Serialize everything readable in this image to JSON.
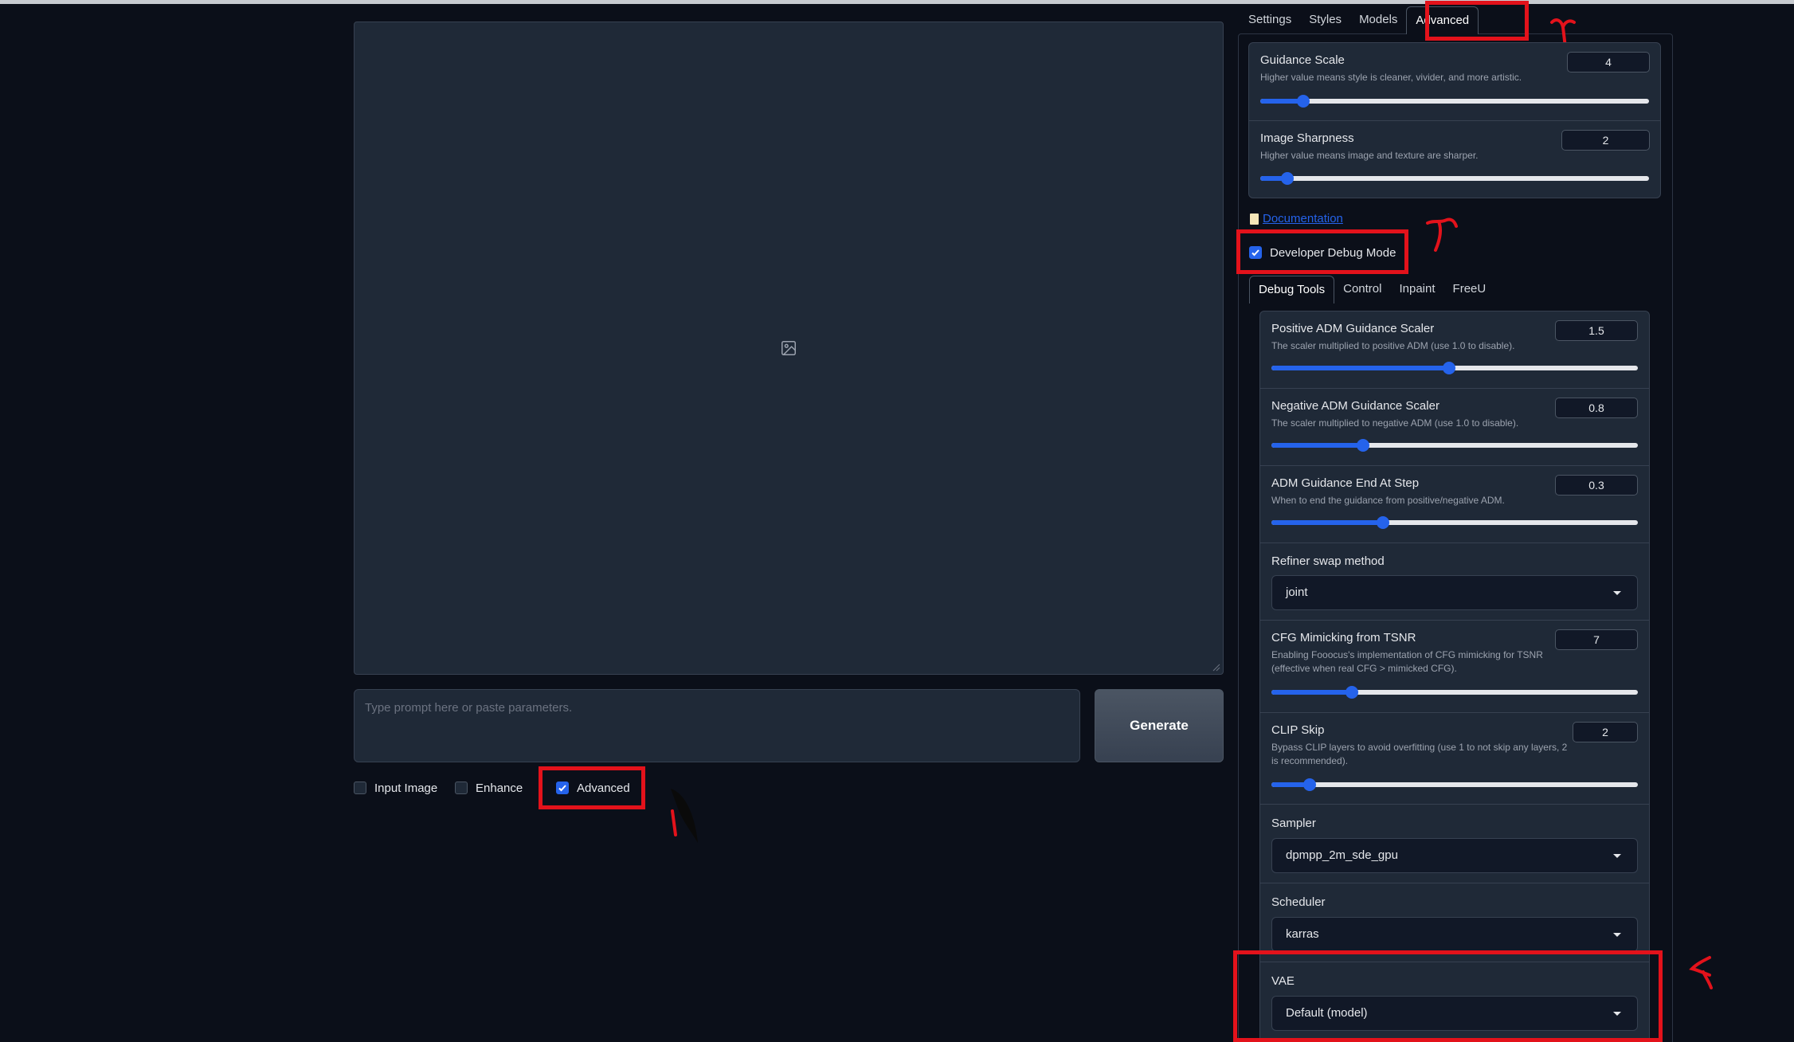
{
  "left": {
    "prompt_placeholder": "Type prompt here or paste parameters.",
    "generate_label": "Generate",
    "checkboxes": [
      {
        "label": "Input Image",
        "checked": false
      },
      {
        "label": "Enhance",
        "checked": false
      },
      {
        "label": "Advanced",
        "checked": true
      }
    ]
  },
  "top_tabs": [
    "Settings",
    "Styles",
    "Models",
    "Advanced"
  ],
  "active_top_tab": "Advanced",
  "guidance_scale": {
    "label": "Guidance Scale",
    "desc": "Higher value means style is cleaner, vivider, and more artistic.",
    "value": "4",
    "fraction": 0.11
  },
  "image_sharpness": {
    "label": "Image Sharpness",
    "desc": "Higher value means image and texture are sharper.",
    "value": "2",
    "fraction": 0.07
  },
  "documentation_label": "Documentation",
  "developer_debug_mode": {
    "label": "Developer Debug Mode",
    "checked": true
  },
  "inner_tabs": [
    "Debug Tools",
    "Control",
    "Inpaint",
    "FreeU"
  ],
  "active_inner_tab": "Debug Tools",
  "positive_adm": {
    "label": "Positive ADM Guidance Scaler",
    "desc": "The scaler multiplied to positive ADM (use 1.0 to disable).",
    "value": "1.5",
    "fraction": 0.485
  },
  "negative_adm": {
    "label": "Negative ADM Guidance Scaler",
    "desc": "The scaler multiplied to negative ADM (use 1.0 to disable).",
    "value": "0.8",
    "fraction": 0.25
  },
  "adm_end": {
    "label": "ADM Guidance End At Step",
    "desc": "When to end the guidance from positive/negative ADM.",
    "value": "0.3",
    "fraction": 0.305
  },
  "refiner_swap": {
    "label": "Refiner swap method",
    "value": "joint"
  },
  "cfg_mimicking": {
    "label": "CFG Mimicking from TSNR",
    "desc1": "Enabling Fooocus's implementation of CFG mimicking for TSNR",
    "desc2": "(effective when real CFG > mimicked CFG).",
    "value": "7",
    "fraction": 0.22
  },
  "clip_skip": {
    "label": "CLIP Skip",
    "desc1": "Bypass CLIP layers to avoid overfitting (use 1 to not skip any layers, 2",
    "desc2": "is recommended).",
    "value": "2",
    "fraction": 0.105
  },
  "sampler": {
    "label": "Sampler",
    "value": "dpmpp_2m_sde_gpu"
  },
  "scheduler": {
    "label": "Scheduler",
    "value": "karras"
  },
  "vae": {
    "label": "VAE",
    "value": "Default (model)"
  },
  "colors": {
    "accent": "#2563eb",
    "annotation": "#e3121b",
    "background": "#0b0f19",
    "panel": "#1f2937"
  }
}
